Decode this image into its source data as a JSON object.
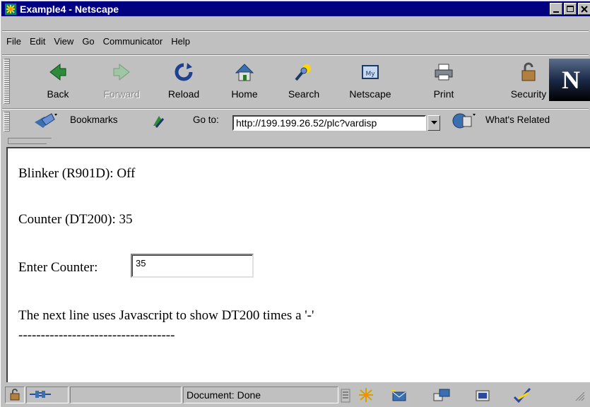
{
  "window": {
    "title": "Example4 - Netscape",
    "minimize": "_",
    "maximize": "□",
    "close": "×"
  },
  "menu": {
    "items": [
      "File",
      "Edit",
      "View",
      "Go",
      "Communicator",
      "Help"
    ]
  },
  "nav_toolbar": {
    "buttons": [
      {
        "label": "Back",
        "icon": "back-arrow-icon",
        "enabled": true
      },
      {
        "label": "Forward",
        "icon": "forward-arrow-icon",
        "enabled": false
      },
      {
        "label": "Reload",
        "icon": "reload-icon",
        "enabled": true
      },
      {
        "label": "Home",
        "icon": "home-icon",
        "enabled": true
      },
      {
        "label": "Search",
        "icon": "search-icon",
        "enabled": true
      },
      {
        "label": "Netscape",
        "icon": "netscape-icon",
        "enabled": true
      },
      {
        "label": "Print",
        "icon": "printer-icon",
        "enabled": true
      },
      {
        "label": "Security",
        "icon": "lock-icon",
        "enabled": true
      }
    ],
    "logo": "N"
  },
  "location_toolbar": {
    "bookmarks_label": "Bookmarks",
    "goto_label": "Go to:",
    "url": "http://199.199.26.52/plc?vardisp",
    "whats_related_label": "What's Related"
  },
  "content": {
    "blinker_line": "Blinker (R901D): Off",
    "counter_line": "Counter (DT200): 35",
    "enter_counter_label": "Enter Counter:",
    "counter_value": "35",
    "javascript_line": "The next line uses Javascript to show DT200 times a '-'",
    "dash_line": "-----------------------------------"
  },
  "status": {
    "text": "Document: Done"
  },
  "colors": {
    "titlebar": "#000080",
    "chrome": "#c0c0c0",
    "content_bg": "#ffffff"
  }
}
